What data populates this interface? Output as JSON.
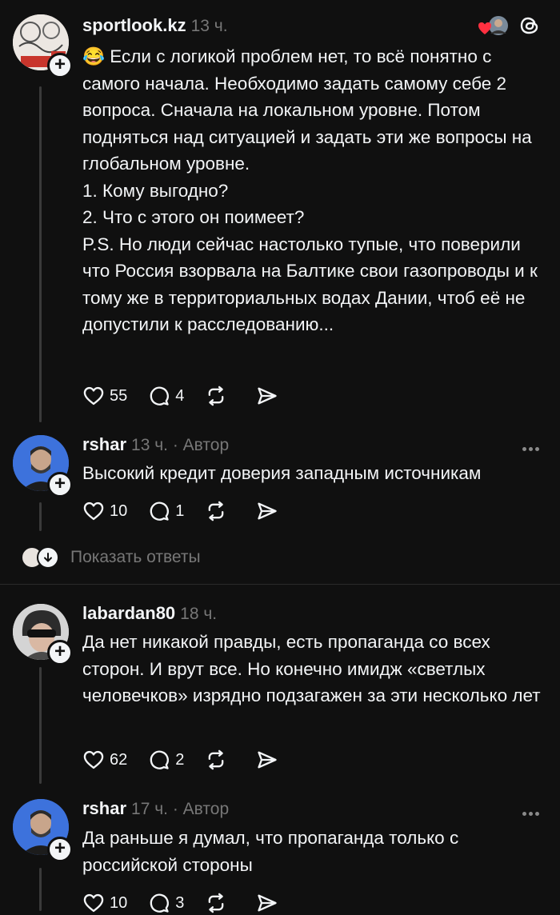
{
  "comments": [
    {
      "username": "sportlook.kz",
      "time": "13 ч.",
      "emoji": "😂",
      "lines": [
        "Если с логикой проблем нет, то всё понятно с самого начала. Необходимо задать самому себе 2 вопроса. Сначала на локальном уровне. Потом подняться над ситуацией и задать эти же вопросы на глобальном уровне.",
        "1. Кому выгодно?",
        "2. Что с этого он поимеет?",
        "P.S. Но люди сейчас настолько тупые, что поверили что Россия взорвала на Балтике свои газопроводы и к тому же в территориальных водах Дании, чтоб её не допустили к расследованию..."
      ],
      "likes": "55",
      "replies": "4"
    },
    {
      "username": "rshar",
      "time": "13 ч. · Автор",
      "lines": [
        "Высокий кредит доверия западным источникам"
      ],
      "likes": "10",
      "replies": "1"
    },
    {
      "username": "labardan80",
      "time": "18 ч.",
      "lines": [
        "Да нет никакой правды, есть пропаганда со всех сторон. И врут все. Но конечно имидж «светлых человечков» изрядно подзагажен за эти несколько лет"
      ],
      "likes": "62",
      "replies": "2"
    },
    {
      "username": "rshar",
      "time": "17 ч. · Автор",
      "lines": [
        "Да раньше я думал, что пропаганда только с российской стороны"
      ],
      "likes": "10",
      "replies": "3"
    }
  ],
  "show_replies_label": "Показать ответы",
  "icons": {
    "like": "heart-icon",
    "reply": "comment-icon",
    "repost": "repost-icon",
    "share": "share-icon",
    "threads": "threads-logo-icon",
    "liked_badge": "red-heart-icon"
  },
  "colors": {
    "background": "#101010",
    "text": "#f3f5f7",
    "secondary": "#777777",
    "heart": "#ff3040"
  }
}
